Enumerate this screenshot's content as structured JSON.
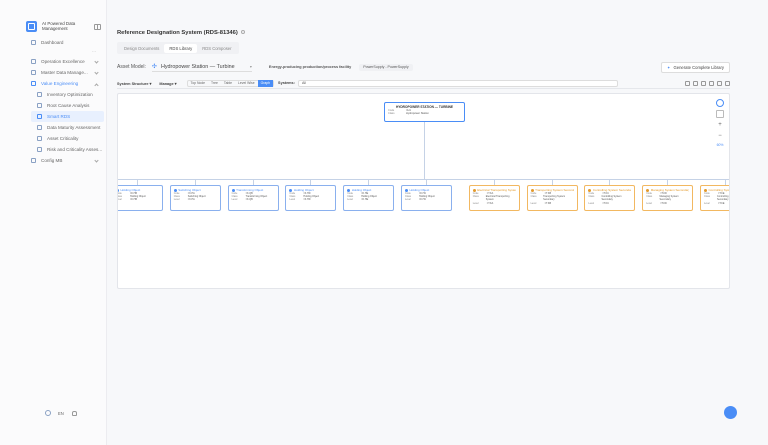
{
  "brand": {
    "name": "AI Powered Data Management"
  },
  "sidebar": {
    "items": [
      {
        "label": "Dashboard",
        "icon": "dashboard-icon",
        "chevron": false
      },
      {
        "label": "Operation Excellence",
        "icon": "gear-icon",
        "chevron": true
      },
      {
        "label": "Master Data Manage...",
        "icon": "database-icon",
        "chevron": true
      },
      {
        "label": "Value Engineering",
        "icon": "bulb-icon",
        "chevron": true
      }
    ],
    "sub_items": [
      {
        "label": "Inventory Optimization",
        "icon": "chart-icon"
      },
      {
        "label": "Root Cause Analysis",
        "icon": "search-icon"
      },
      {
        "label": "Smart RDS",
        "icon": "tree-icon",
        "active": true
      },
      {
        "label": "Data Maturity Assessment",
        "icon": "trend-icon"
      },
      {
        "label": "Asset Criticality",
        "icon": "warning-icon"
      },
      {
        "label": "Risk and Criticality Asses...",
        "icon": "shield-icon"
      }
    ],
    "last_item": {
      "label": "Config MB",
      "icon": "config-icon"
    }
  },
  "footer": {
    "lang": "EN"
  },
  "page": {
    "title": "Reference Designation System (RDS-81346)"
  },
  "tabs": [
    {
      "label": "Design Documents",
      "active": false
    },
    {
      "label": "RDS Library",
      "active": true
    },
    {
      "label": "RDS Composer",
      "active": false
    }
  ],
  "asset": {
    "label": "Asset Model:",
    "value": "Hydropower Station — Turbine",
    "description": "Energy-producing production/process facility",
    "pill": "PowerSupply - PowerSupply",
    "generate_label": "Generate Complete Library"
  },
  "toolbar": {
    "structure_label": "System Structure",
    "manage_label": "Manage",
    "views": [
      {
        "label": "Top Node",
        "active": false
      },
      {
        "label": "Tree",
        "active": false
      },
      {
        "label": "Table",
        "active": false
      },
      {
        "label": "Level Wise",
        "active": false
      },
      {
        "label": "Graph",
        "active": true
      }
    ],
    "systems_label": "Systems:",
    "systems_value": "All"
  },
  "zoom": {
    "percent": "60%"
  },
  "root_node": {
    "title": "HYDROPOWER STATION — TURBINE",
    "rows": [
      {
        "k": "Code",
        "v": "=H1"
      },
      {
        "k": "Class",
        "v": "Hydropower Station"
      }
    ]
  },
  "nodes": [
    {
      "title": "Holding Object",
      "color": "blue",
      "code": "=K.HB"
    },
    {
      "title": "Switching Object",
      "color": "blue",
      "code": "=K.HA"
    },
    {
      "title": "Transforming Object",
      "color": "blue",
      "code": "=K.QB"
    },
    {
      "title": "Holding Object",
      "color": "blue",
      "code": "=K.HD"
    },
    {
      "title": "Holding Object",
      "color": "blue",
      "code": "=K.HE"
    },
    {
      "title": "Holding Object",
      "color": "blue",
      "code": "=K.HC"
    },
    {
      "title": "Electrical Transporting System",
      "color": "orange",
      "code": "=T.KA"
    },
    {
      "title": "Transporting System Secondary",
      "color": "orange",
      "code": "=T.KB"
    },
    {
      "title": "Controlling System Secondary",
      "color": "orange",
      "code": "=T.KC"
    },
    {
      "title": "Managing System Secondary",
      "color": "orange",
      "code": "=T.KD"
    },
    {
      "title": "Controlling System Secondary",
      "color": "orange",
      "code": "=T.KE"
    }
  ],
  "node_labels": {
    "code": "Code",
    "class": "Class",
    "level": "Level"
  }
}
